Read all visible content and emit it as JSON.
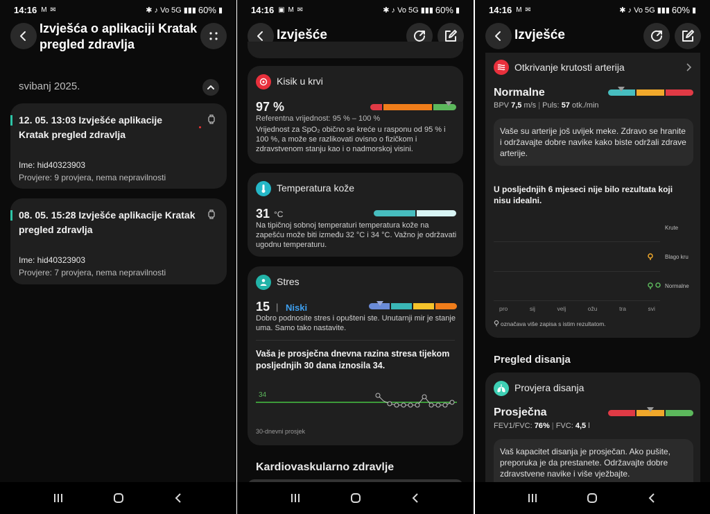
{
  "status": {
    "time": "14:16",
    "battery": "60%",
    "left_icons_1": "M ✉",
    "left_icons_2": "▣ M ✉",
    "left_icons_3": "M ✉",
    "right_icons": "✱ ♪ Vo 5G ▮▮▮"
  },
  "screen1": {
    "title": "Izvješća o aplikaciji Kratak pregled zdravlja",
    "month": "svibanj 2025.",
    "reports": [
      {
        "title": "12. 05. 13:03 Izvješće aplikacije Kratak pregled zdravlja",
        "name": "Ime: hid40323903",
        "checks": "Provjere: 9 provjera, nema nepravilnosti"
      },
      {
        "title": "08. 05. 15:28 Izvješće aplikacije Kratak pregled zdravlja",
        "name": "Ime: hid40323903",
        "checks": "Provjere: 7 provjera, nema nepravilnosti"
      }
    ]
  },
  "screen2": {
    "title": "Izvješće",
    "oxygen": {
      "label": "Kisik u krvi",
      "value": "97 %",
      "ref": "Referentna vrijednost: 95 % – 100 %",
      "desc": "Vrijednost za SpO₂ obično se kreće u rasponu od 95 % i 100 %, a može se razlikovati ovisno o fizičkom i zdravstvenom stanju kao i o nadmorskoj visini."
    },
    "skin": {
      "label": "Temperatura kože",
      "value": "31",
      "unit": "°C",
      "desc": "Na tipičnoj sobnoj temperaturi temperatura kože na zapešću može biti između 32 °C i 34 °C. Važno je održavati ugodnu temperaturu."
    },
    "stress": {
      "label": "Stres",
      "value": "15",
      "sep": "|",
      "level": "Niski",
      "desc": "Dobro podnosite stres i opušteni ste. Unutarnji mir je stanje uma. Samo tako nastavite.",
      "avg_text": "Vaša je prosječna dnevna razina stresa tijekom posljednjih 30 dana iznosila 34.",
      "avg_value": "34",
      "chart_note": "30-dnevni prosjek"
    },
    "next_section": "Kardiovaskularno zdravlje"
  },
  "screen3": {
    "title": "Izvješće",
    "artery": {
      "label": "Otkrivanje krutosti arterija",
      "status": "Normalne",
      "bpv_label": "BPV",
      "bpv_value": "7,5",
      "bpv_unit": "m/s",
      "pulse_label": "Puls:",
      "pulse_value": "57",
      "pulse_unit": "otk./min",
      "desc": "Vaše su arterije još uvijek meke. Zdravo se hranite i održavajte dobre navike kako biste održali zdrave arterije.",
      "history_text": "U posljednjih 6 mjeseci nije bilo rezultata koji nisu idealni.",
      "y_labels": [
        "Krute",
        "Blago kru",
        "Normalne"
      ],
      "x_labels": [
        "pro",
        "sij",
        "velj",
        "ožu",
        "tra",
        "svi"
      ],
      "legend": "označava više zapisa s istim rezultatom."
    },
    "breath_section": "Pregled disanja",
    "breath": {
      "label": "Provjera disanja",
      "status": "Prosječna",
      "fev_label": "FEV1/FVC:",
      "fev_value": "76",
      "fev_unit": "%",
      "fvc_label": "FVC:",
      "fvc_value": "4,5",
      "fvc_unit": "l",
      "desc": "Vaš kapacitet disanja je prosječan. Ako pušite, preporuka je da prestanete. Održavajte dobre zdravstvene navike i više vježbajte."
    }
  },
  "icons": {
    "back": "chevron-left-icon",
    "more": "more-dots-icon",
    "share": "share-icon",
    "edit": "edit-icon"
  }
}
